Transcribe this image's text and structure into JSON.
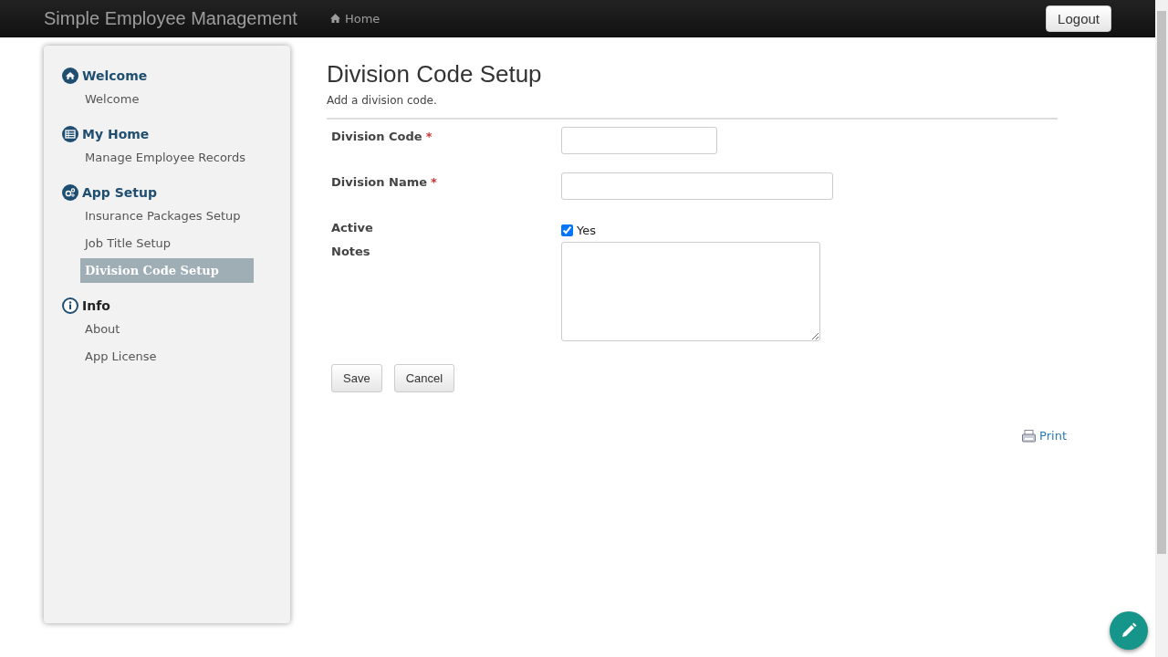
{
  "navbar": {
    "brand": "Simple Employee Management",
    "links": [
      {
        "label": "Home"
      }
    ],
    "logout": "Logout"
  },
  "sidebar": {
    "sections": [
      {
        "title": "Welcome",
        "items": [
          {
            "label": "Welcome",
            "selected": false
          }
        ]
      },
      {
        "title": "My Home",
        "items": [
          {
            "label": "Manage Employee Records",
            "selected": false
          }
        ]
      },
      {
        "title": "App Setup",
        "items": [
          {
            "label": "Insurance Packages Setup",
            "selected": false
          },
          {
            "label": "Job Title Setup",
            "selected": false
          },
          {
            "label": "Division Code Setup",
            "selected": true
          }
        ]
      },
      {
        "title": "Info",
        "items": [
          {
            "label": "About",
            "selected": false
          },
          {
            "label": "App License",
            "selected": false
          }
        ]
      }
    ]
  },
  "page": {
    "title": "Division Code Setup",
    "subtitle": "Add a division code."
  },
  "form": {
    "fields": [
      {
        "kind": "text",
        "label": "Division Code",
        "required": true
      },
      {
        "kind": "text",
        "label": "Division Name",
        "required": true
      },
      {
        "kind": "checkbox",
        "label": "Active",
        "option": "Yes",
        "checked": true
      },
      {
        "kind": "textarea",
        "label": "Notes",
        "required": false
      }
    ],
    "required_mark": "*",
    "buttons": [
      "Save",
      "Cancel"
    ]
  },
  "print": "Print"
}
